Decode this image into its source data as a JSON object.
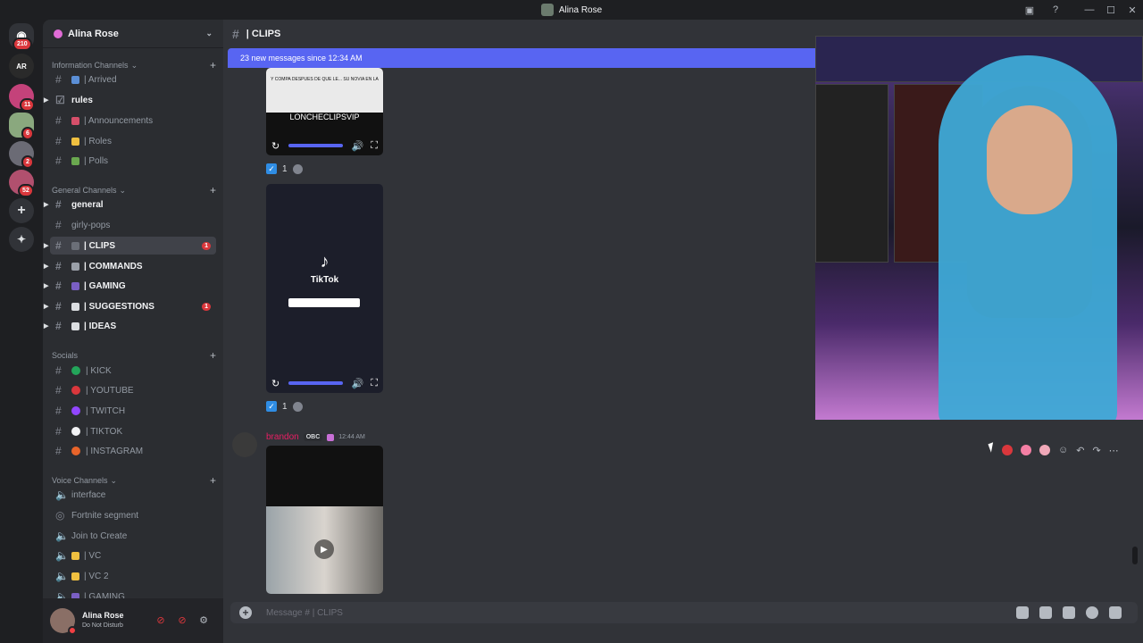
{
  "window": {
    "title": "Alina Rose"
  },
  "servers": {
    "home_badge": "210",
    "items": [
      {
        "name": "AR",
        "badge": ""
      },
      {
        "name": "",
        "badge": "11"
      },
      {
        "name": "",
        "badge": "6"
      },
      {
        "name": "",
        "badge": "2"
      },
      {
        "name": "",
        "badge": "52"
      }
    ]
  },
  "sidebar": {
    "guild_name": "Alina Rose",
    "categories": {
      "info": "Information Channels",
      "general": "General Channels",
      "socials": "Socials",
      "voice": "Voice Channels"
    },
    "info_channels": [
      "| Arrived",
      "rules",
      "| Announcements",
      "| Roles",
      "| Polls"
    ],
    "general_channels": [
      {
        "label": "general",
        "mention": ""
      },
      {
        "label": "girly-pops",
        "mention": ""
      },
      {
        "label": "| CLIPS",
        "mention": "1"
      },
      {
        "label": "| COMMANDS",
        "mention": ""
      },
      {
        "label": "| GAMING",
        "mention": ""
      },
      {
        "label": "| SUGGESTIONS",
        "mention": "1"
      },
      {
        "label": "| IDEAS",
        "mention": ""
      }
    ],
    "social_channels": [
      {
        "label": "| KICK",
        "color": "#23a55a"
      },
      {
        "label": "| YOUTUBE",
        "color": "#da373c"
      },
      {
        "label": "| TWITCH",
        "color": "#9146ff"
      },
      {
        "label": "| TIKTOK",
        "color": "#f2f3f5"
      },
      {
        "label": "| INSTAGRAM",
        "color": "#e8642a"
      }
    ],
    "voice_channels": [
      "interface",
      "Fortnite segment",
      "Join to Create",
      "| VC",
      "| VC 2",
      "| GAMING"
    ]
  },
  "user": {
    "name": "Alina Rose",
    "status": "Do Not Disturb"
  },
  "channel": {
    "name": "| CLIPS"
  },
  "banner": {
    "text": "23 new messages since 12:34 AM"
  },
  "messages": {
    "clip1": {
      "caption_top": "Y COMPA DESPUES DE QUE LE... SU NOVIA EN LA",
      "watermark": "LONCHECLIPSVIP",
      "reaction_count": "1"
    },
    "clip2": {
      "brand": "TikTok",
      "reaction_count": "1"
    },
    "post": {
      "author": "brandon",
      "tag": "OBC",
      "time": "12:44 AM"
    }
  },
  "composer": {
    "placeholder": "Message # | CLIPS"
  },
  "colors": {
    "accent": "#5865f2",
    "mention_red": "#da373c",
    "author": "#e91e63"
  }
}
